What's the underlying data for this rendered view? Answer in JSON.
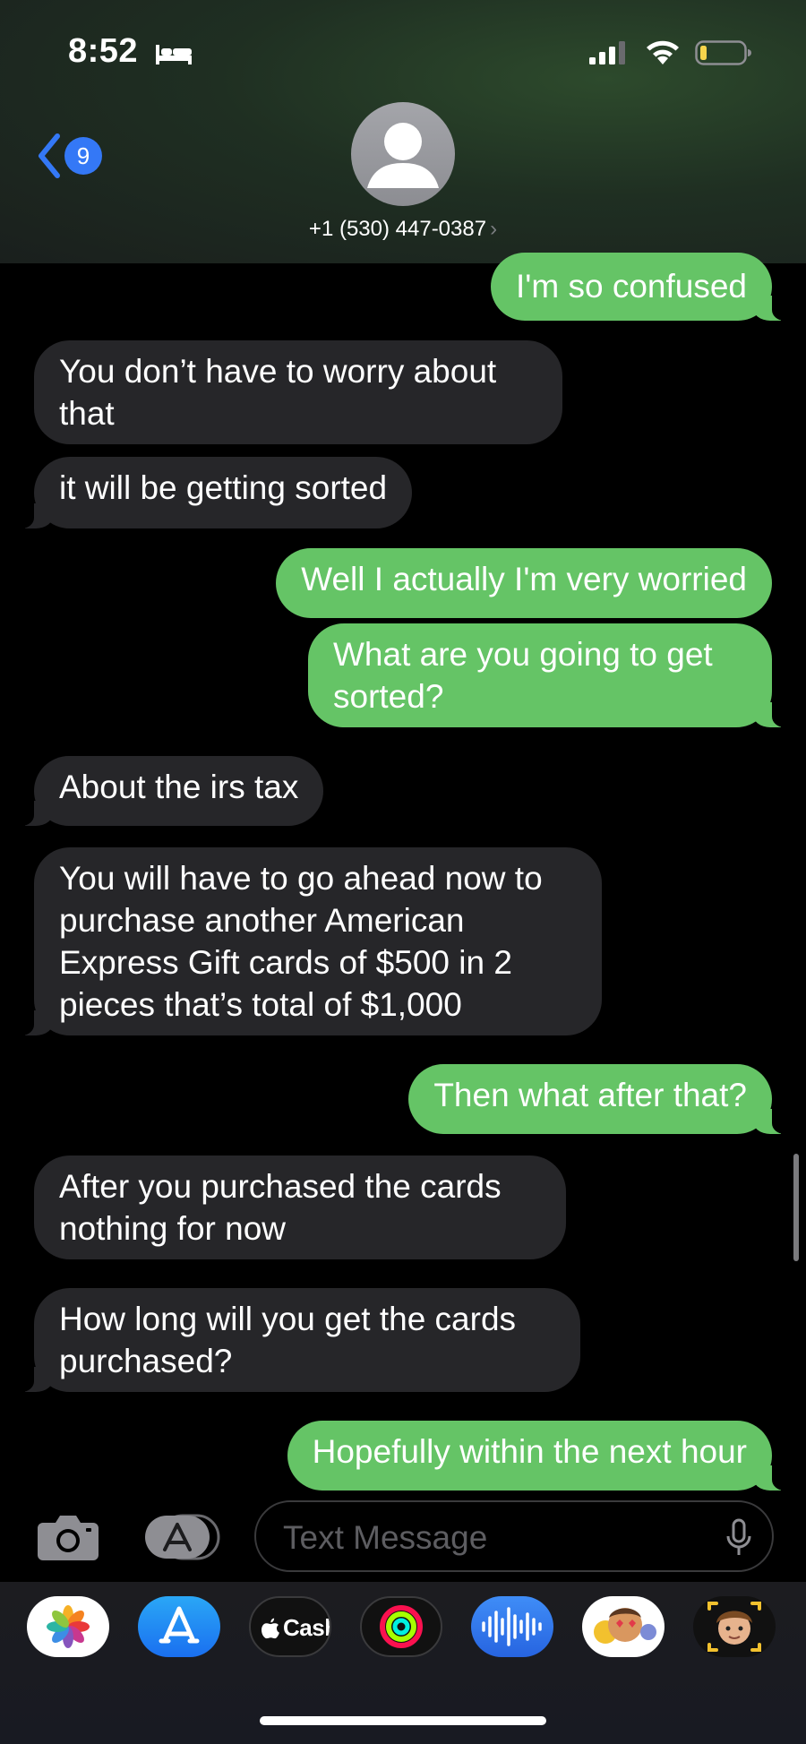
{
  "status_bar": {
    "time": "8:52"
  },
  "header": {
    "back_count": "9",
    "contact": "+1 (530) 447-0387",
    "chevron": "›"
  },
  "messages": [
    {
      "direction": "outgoing",
      "text": "I'm so confused"
    },
    {
      "direction": "incoming",
      "text": "You don’t have to worry about\nthat"
    },
    {
      "direction": "incoming",
      "text": "it will be getting sorted"
    },
    {
      "direction": "outgoing",
      "text": "Well I actually I'm very worried"
    },
    {
      "direction": "outgoing",
      "text": "What are you going to get\nsorted?"
    },
    {
      "direction": "incoming",
      "text": "About the irs tax"
    },
    {
      "direction": "incoming",
      "text": "You will have to go ahead now to\npurchase another American\nExpress Gift cards of $500 in 2\npieces that’s total of $1,000"
    },
    {
      "direction": "outgoing",
      "text": "Then what after that?"
    },
    {
      "direction": "incoming",
      "text": "After you purchased the cards\nnothing for now"
    },
    {
      "direction": "incoming",
      "text": "How long will you get the cards\npurchased?"
    },
    {
      "direction": "outgoing",
      "text": "Hopefully within the next hour"
    }
  ],
  "composer": {
    "placeholder": "Text Message"
  },
  "app_drawer": [
    {
      "name": "photos-icon"
    },
    {
      "name": "app-store-icon"
    },
    {
      "name": "apple-cash-icon",
      "label": "Cash"
    },
    {
      "name": "activity-icon"
    },
    {
      "name": "audio-message-icon"
    },
    {
      "name": "memoji-stickers-icon"
    },
    {
      "name": "animoji-icon"
    }
  ],
  "colors": {
    "outgoing": "#65c466",
    "incoming": "#262629",
    "accent": "#3478f6"
  }
}
